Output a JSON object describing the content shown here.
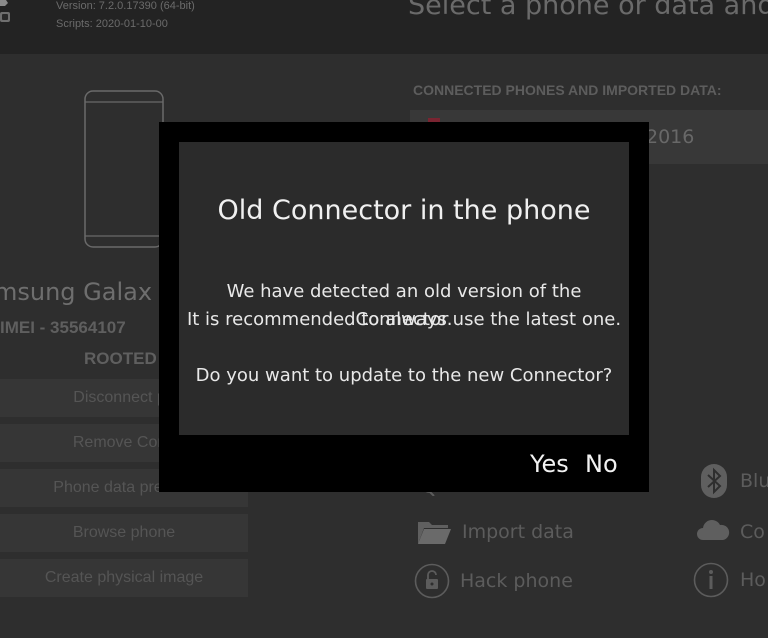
{
  "header": {
    "version": "Version: 7.2.0.17390 (64-bit)",
    "scripts": "Scripts: 2020-01-10-00",
    "page_heading": "Select a phone or data and p"
  },
  "device": {
    "name": "msung Galax",
    "imei": "IMEI - 35564107",
    "status": "ROOTED"
  },
  "actions": [
    {
      "label": "Disconnect ph"
    },
    {
      "label": "Remove Conn"
    },
    {
      "label": "Phone data preview"
    },
    {
      "label": "Browse phone"
    },
    {
      "label": "Create physical image"
    }
  ],
  "connected": {
    "section_label": "CONNECTED PHONES AND IMPORTED DATA:",
    "item_text": "2016"
  },
  "options": {
    "import_data": "Import data",
    "hack_phone": "Hack phone",
    "bluetooth": "Blu",
    "cloud": "Co",
    "info": "Ho"
  },
  "dialog": {
    "title": "Old Connector in the phone",
    "line1": "We have detected an old version of the Connector.",
    "line2": "It is recommended to always use the latest one.",
    "question": "Do you want to update to the new Connector?",
    "yes_label": "Yes",
    "no_label": "No"
  },
  "colors": {
    "dialog_frame": "#000000",
    "dialog_body": "#2b2b2b",
    "accent_marker": "#7a2431"
  }
}
